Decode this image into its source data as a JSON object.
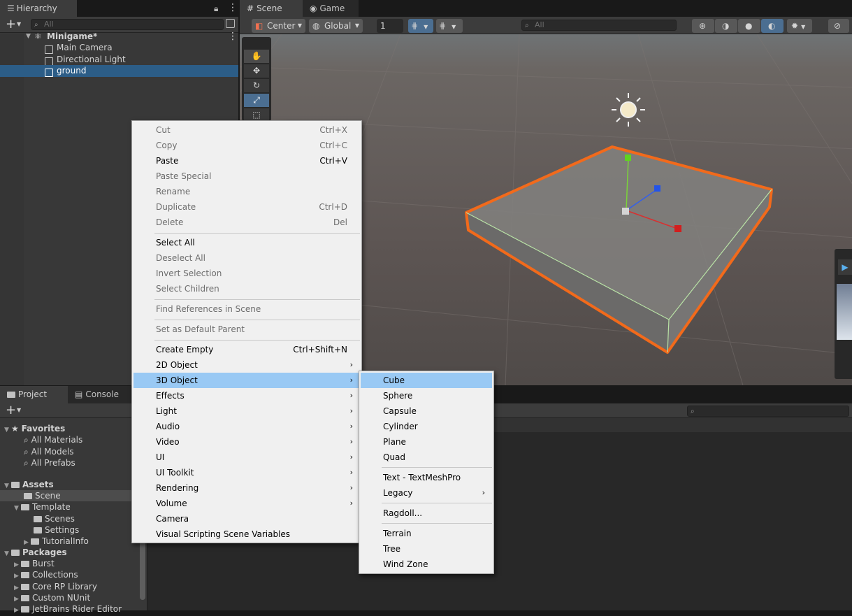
{
  "hierarchy": {
    "tab": "Hierarchy",
    "search_placeholder": "All",
    "scene_name": "Minigame*",
    "items": [
      "Main Camera",
      "Directional Light",
      "ground"
    ]
  },
  "scene_tabs": {
    "scene": "Scene",
    "game": "Game"
  },
  "scene_toolbar": {
    "pivot": "Center",
    "space": "Global",
    "snap_value": "1",
    "search_placeholder": "All"
  },
  "project": {
    "tabs": {
      "project": "Project",
      "console": "Console"
    },
    "favorites": {
      "label": "Favorites",
      "items": [
        "All Materials",
        "All Models",
        "All Prefabs"
      ]
    },
    "assets": {
      "label": "Assets",
      "items": [
        "Scene",
        "Template",
        "Scenes",
        "Settings",
        "TutorialInfo"
      ]
    },
    "packages": {
      "label": "Packages",
      "items": [
        "Burst",
        "Collections",
        "Core RP Library",
        "Custom NUnit",
        "JetBrains Rider Editor"
      ]
    }
  },
  "context_menu": {
    "items": [
      {
        "label": "Cut",
        "shortcut": "Ctrl+X"
      },
      {
        "label": "Copy",
        "shortcut": "Ctrl+C"
      },
      {
        "label": "Paste",
        "shortcut": "Ctrl+V"
      },
      {
        "label": "Paste Special",
        "shortcut": ""
      },
      {
        "label": "Rename",
        "shortcut": ""
      },
      {
        "label": "Duplicate",
        "shortcut": "Ctrl+D"
      },
      {
        "label": "Delete",
        "shortcut": "Del"
      },
      {
        "label": "Select All"
      },
      {
        "label": "Deselect All"
      },
      {
        "label": "Invert Selection"
      },
      {
        "label": "Select Children"
      },
      {
        "label": "Find References in Scene"
      },
      {
        "label": "Set as Default Parent"
      },
      {
        "label": "Create Empty",
        "shortcut": "Ctrl+Shift+N"
      },
      {
        "label": "2D Object"
      },
      {
        "label": "3D Object"
      },
      {
        "label": "Effects"
      },
      {
        "label": "Light"
      },
      {
        "label": "Audio"
      },
      {
        "label": "Video"
      },
      {
        "label": "UI"
      },
      {
        "label": "UI Toolkit"
      },
      {
        "label": "Rendering"
      },
      {
        "label": "Volume"
      },
      {
        "label": "Camera"
      },
      {
        "label": "Visual Scripting Scene Variables"
      }
    ]
  },
  "submenu_3d": {
    "items": [
      "Cube",
      "Sphere",
      "Capsule",
      "Cylinder",
      "Plane",
      "Quad",
      "Text - TextMeshPro",
      "Legacy",
      "Ragdoll...",
      "Terrain",
      "Tree",
      "Wind Zone"
    ]
  },
  "colors": {
    "highlight": "#99c9f4",
    "selection": "#2c5d87",
    "outline": "#f26a1b"
  }
}
